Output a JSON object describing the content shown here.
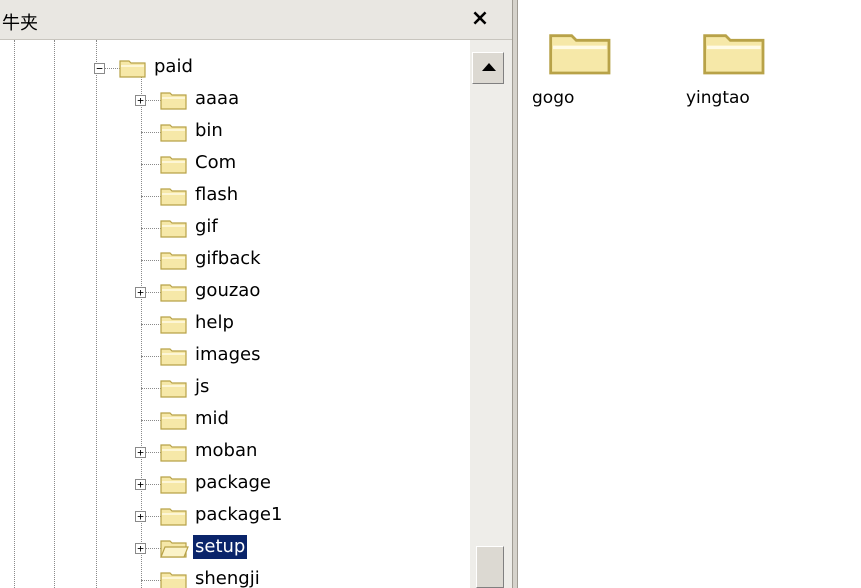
{
  "panel": {
    "title": "牛夹",
    "close_label": "×"
  },
  "tree": {
    "root": {
      "label": "paid",
      "expander": "−"
    },
    "items": [
      {
        "label": "aaaa",
        "expander": "+"
      },
      {
        "label": "bin",
        "expander": ""
      },
      {
        "label": "Com",
        "expander": ""
      },
      {
        "label": "flash",
        "expander": ""
      },
      {
        "label": "gif",
        "expander": ""
      },
      {
        "label": "gifback",
        "expander": ""
      },
      {
        "label": "gouzao",
        "expander": "+"
      },
      {
        "label": "help",
        "expander": ""
      },
      {
        "label": "images",
        "expander": ""
      },
      {
        "label": "js",
        "expander": ""
      },
      {
        "label": "mid",
        "expander": ""
      },
      {
        "label": "moban",
        "expander": "+"
      },
      {
        "label": "package",
        "expander": "+"
      },
      {
        "label": "package1",
        "expander": "+"
      },
      {
        "label": "setup",
        "expander": "+",
        "selected": true
      },
      {
        "label": "shengji",
        "expander": ""
      }
    ]
  },
  "files": [
    {
      "label": "gogo"
    },
    {
      "label": "yingtao"
    }
  ],
  "colors": {
    "folder_fill": "#f6e8a8",
    "folder_stroke": "#b8a248",
    "selection": "#0a246a"
  }
}
